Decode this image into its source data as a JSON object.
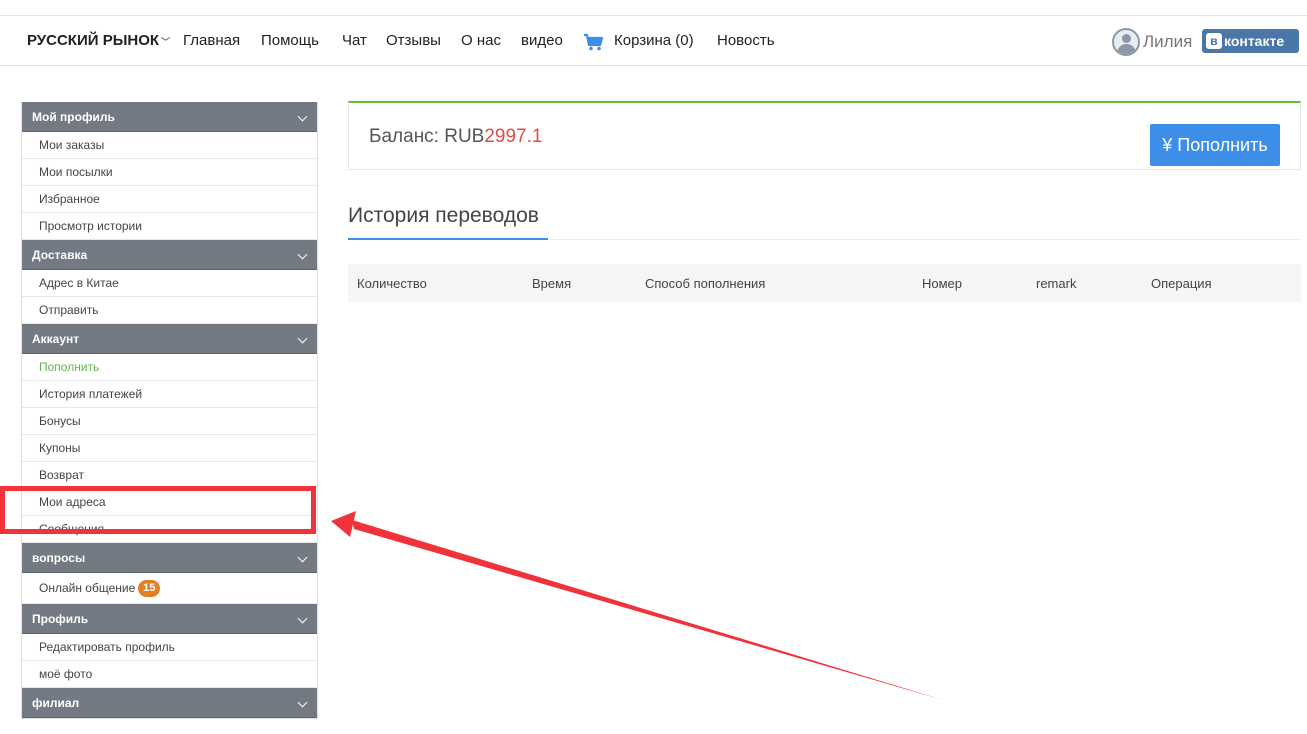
{
  "nav": {
    "brand": "РУССКИЙ РЫНОК",
    "links": [
      "Главная",
      "Помощь",
      "Чат",
      "Отзывы",
      "О нас",
      "видео"
    ],
    "cart": "Корзина (0)",
    "news": "Новость",
    "user": "Лилия",
    "vk": "контакте",
    "vk_logo": "в"
  },
  "sidebar": {
    "profile": {
      "title": "Мой профиль",
      "items": [
        "Мои заказы",
        "Мои посылки",
        "Избранное",
        "Просмотр истории"
      ]
    },
    "delivery": {
      "title": "Доставка",
      "items": [
        "Адрес в Китае",
        "Отправить"
      ]
    },
    "account": {
      "title": "Аккаунт",
      "items": [
        "Пополнить",
        "История платежей",
        "Бонусы",
        "Купоны",
        "Возврат",
        "Мои адреса",
        "Сообщения"
      ]
    },
    "questions": {
      "title": "вопросы",
      "items": [
        "Онлайн общение"
      ],
      "badge": "15"
    },
    "profile2": {
      "title": "Профиль",
      "items": [
        "Редактировать профиль",
        "моё фото"
      ]
    },
    "branch": {
      "title": "филиал"
    }
  },
  "balance": {
    "label": "Баланс: RUB",
    "value": "2997.1",
    "button": "¥ Пополнить"
  },
  "history": {
    "title": "История переводов",
    "columns": [
      "Количество",
      "Время",
      "Способ пополнения",
      "Номер",
      "remark",
      "Операция"
    ]
  },
  "colors": {
    "accent": "#3c8ee8",
    "active": "#63b34a",
    "balance_value": "#e44a4a",
    "annotation": "#f0333a"
  }
}
